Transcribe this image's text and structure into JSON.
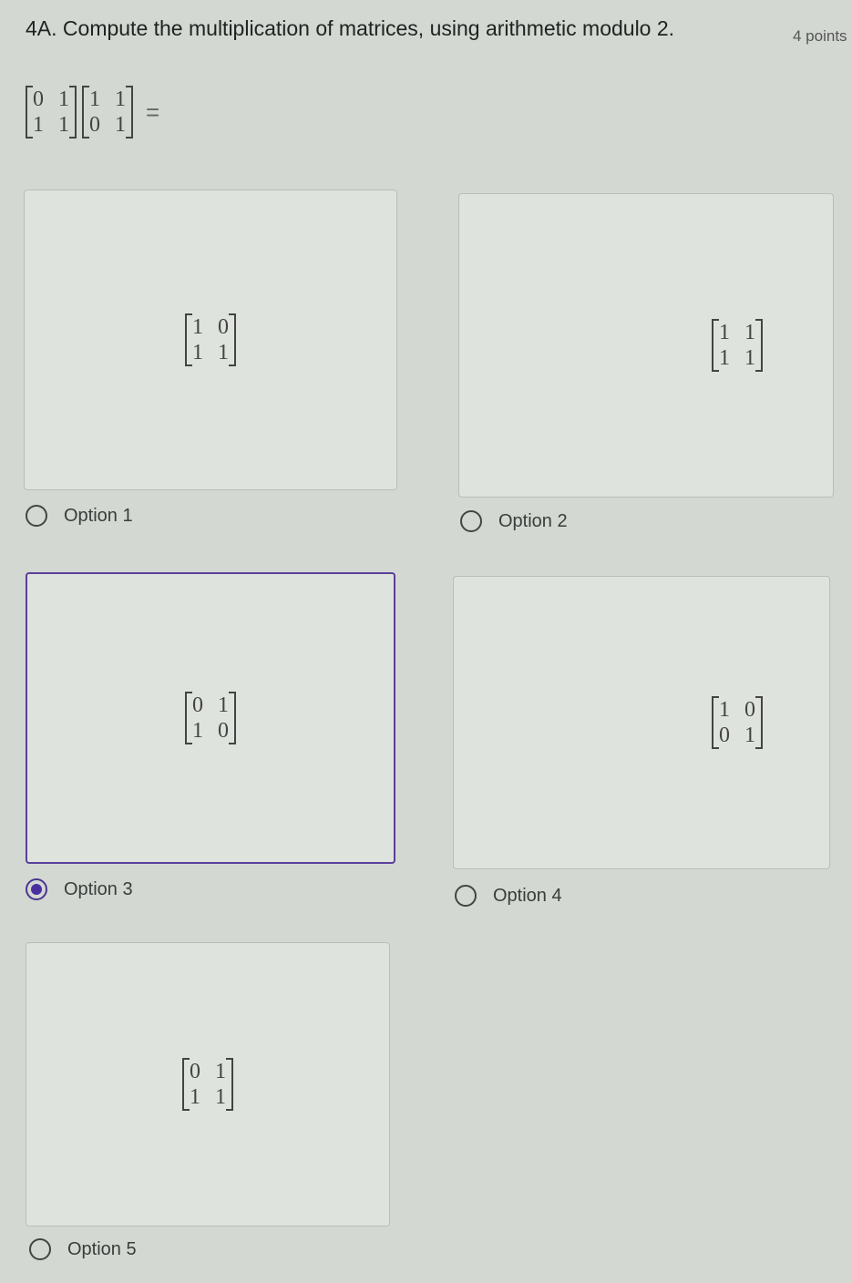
{
  "question": {
    "title": "4A. Compute the multiplication of matrices, using arithmetic modulo 2.",
    "points": "4 points",
    "matrix_a": [
      [
        "0",
        "1"
      ],
      [
        "1",
        "1"
      ]
    ],
    "matrix_b": [
      [
        "1",
        "1"
      ],
      [
        "0",
        "1"
      ]
    ],
    "equals": "="
  },
  "options": [
    {
      "label": "Option 1",
      "matrix": [
        [
          "1",
          "0"
        ],
        [
          "1",
          "1"
        ]
      ],
      "selected": false
    },
    {
      "label": "Option 2",
      "matrix": [
        [
          "1",
          "1"
        ],
        [
          "1",
          "1"
        ]
      ],
      "selected": false
    },
    {
      "label": "Option 3",
      "matrix": [
        [
          "0",
          "1"
        ],
        [
          "1",
          "0"
        ]
      ],
      "selected": true
    },
    {
      "label": "Option 4",
      "matrix": [
        [
          "1",
          "0"
        ],
        [
          "0",
          "1"
        ]
      ],
      "selected": false
    },
    {
      "label": "Option 5",
      "matrix": [
        [
          "0",
          "1"
        ],
        [
          "1",
          "1"
        ]
      ],
      "selected": false
    }
  ]
}
